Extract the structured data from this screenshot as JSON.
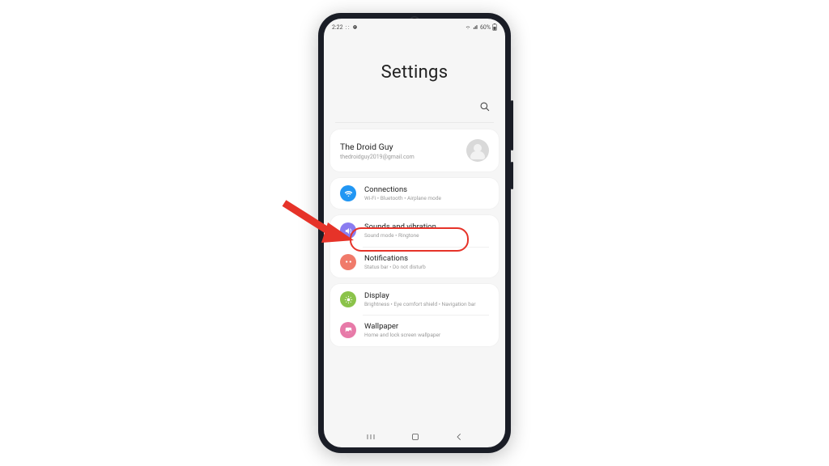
{
  "status_bar": {
    "time": "2:22",
    "battery_pct": "60%"
  },
  "header": {
    "title": "Settings"
  },
  "account": {
    "name": "The Droid Guy",
    "email": "thedroidguy2019@gmail.com"
  },
  "groups": [
    {
      "rows": [
        {
          "id": "connections",
          "icon": "wifi",
          "color": "#2196f3",
          "title": "Connections",
          "sub": "Wi-Fi  •  Bluetooth  •  Airplane mode"
        }
      ]
    },
    {
      "rows": [
        {
          "id": "sounds",
          "icon": "sound",
          "color": "#8a7cf0",
          "title": "Sounds and vibration",
          "sub": "Sound mode  •  Ringtone"
        },
        {
          "id": "notifications",
          "icon": "notif",
          "color": "#f07a6a",
          "title": "Notifications",
          "sub": "Status bar  •  Do not disturb"
        }
      ]
    },
    {
      "rows": [
        {
          "id": "display",
          "icon": "display",
          "color": "#8bc34a",
          "title": "Display",
          "sub": "Brightness  •  Eye comfort shield  •  Navigation bar"
        },
        {
          "id": "wallpaper",
          "icon": "wallpaper",
          "color": "#e77aa8",
          "title": "Wallpaper",
          "sub": "Home and lock screen wallpaper"
        }
      ]
    }
  ],
  "annotation": {
    "target": "connections"
  }
}
